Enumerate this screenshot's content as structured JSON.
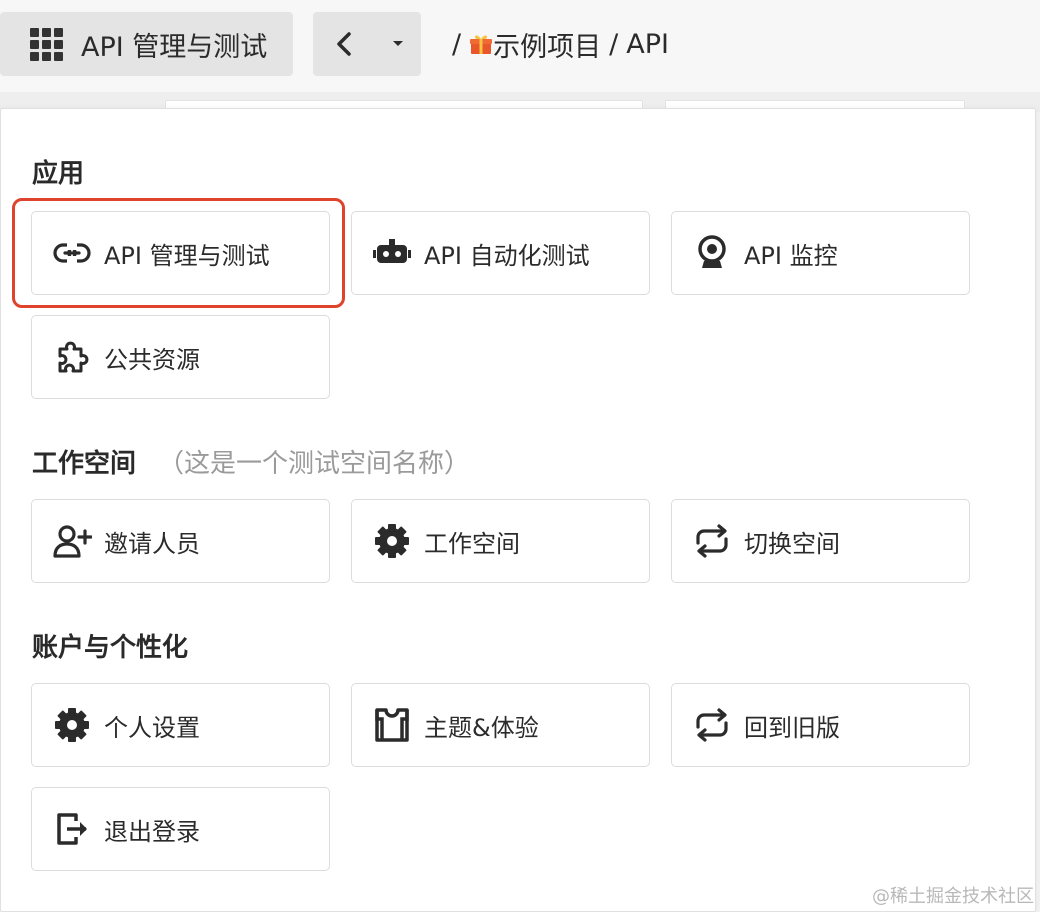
{
  "topbar": {
    "app_title": "API 管理与测试",
    "breadcrumb": {
      "separator": "/",
      "project": "示例项目",
      "page": "API"
    }
  },
  "panel": {
    "sections": [
      {
        "title": "应用",
        "items": [
          {
            "label": "API 管理与测试",
            "icon": "link-icon",
            "highlighted": true
          },
          {
            "label": "API 自动化测试",
            "icon": "robot-icon"
          },
          {
            "label": "API 监控",
            "icon": "webcam-icon"
          },
          {
            "label": "公共资源",
            "icon": "puzzle-icon"
          }
        ]
      },
      {
        "title": "工作空间",
        "subtitle": "（这是一个测试空间名称）",
        "items": [
          {
            "label": "邀请人员",
            "icon": "add-user-icon"
          },
          {
            "label": "工作空间",
            "icon": "gear-icon"
          },
          {
            "label": "切换空间",
            "icon": "switch-icon"
          }
        ]
      },
      {
        "title": "账户与个性化",
        "items": [
          {
            "label": "个人设置",
            "icon": "gear-icon"
          },
          {
            "label": "主题&体验",
            "icon": "shirt-icon"
          },
          {
            "label": "回到旧版",
            "icon": "switch-icon"
          },
          {
            "label": "退出登录",
            "icon": "logout-icon"
          }
        ]
      }
    ]
  },
  "watermark": "@稀土掘金技术社区",
  "colors": {
    "highlight": "#e0432c",
    "tile_border": "#dcdcdc"
  }
}
